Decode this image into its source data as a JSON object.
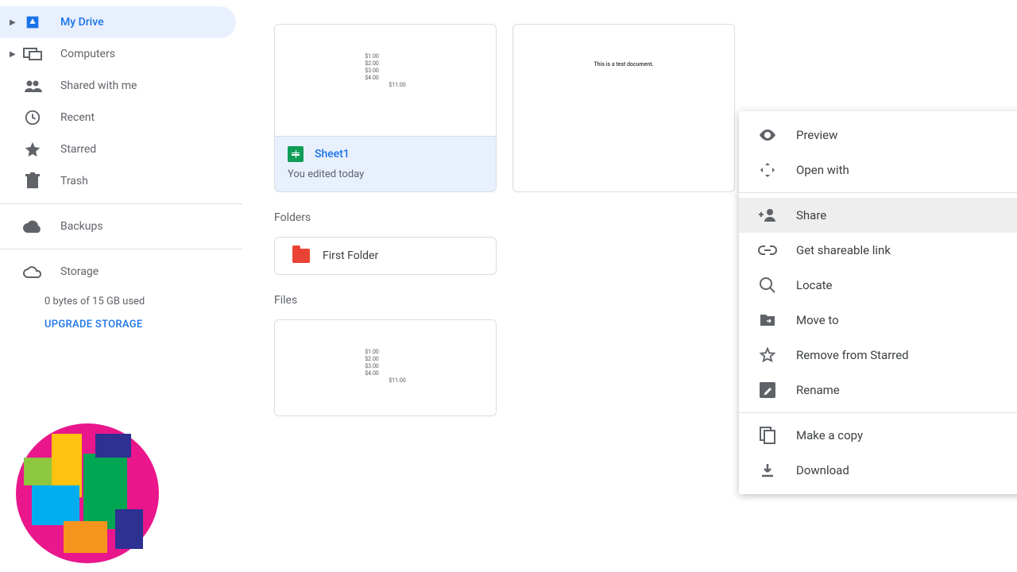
{
  "sidebar": {
    "items": [
      {
        "label": "My Drive"
      },
      {
        "label": "Computers"
      },
      {
        "label": "Shared with me"
      },
      {
        "label": "Recent"
      },
      {
        "label": "Starred"
      },
      {
        "label": "Trash"
      },
      {
        "label": "Backups"
      }
    ],
    "storage_label": "Storage",
    "storage_usage": "0 bytes of 15 GB used",
    "upgrade_label": "UPGRADE STORAGE"
  },
  "files": {
    "card1_name": "Sheet1",
    "card1_sub": "You edited today",
    "card1_preview_rows": [
      "$1.00",
      "$2.00",
      "$3.00",
      "$4.00"
    ],
    "card1_preview_total": "$11.00",
    "card2_text": "This is a test document."
  },
  "sections": {
    "folders": "Folders",
    "files": "Files",
    "folder1_name": "First Folder"
  },
  "menu": {
    "items": [
      {
        "label": "Preview"
      },
      {
        "label": "Open with"
      },
      {
        "label": "Share"
      },
      {
        "label": "Get shareable link"
      },
      {
        "label": "Locate"
      },
      {
        "label": "Move to"
      },
      {
        "label": "Remove from Starred"
      },
      {
        "label": "Rename"
      },
      {
        "label": "Make a copy"
      },
      {
        "label": "Download"
      }
    ]
  }
}
